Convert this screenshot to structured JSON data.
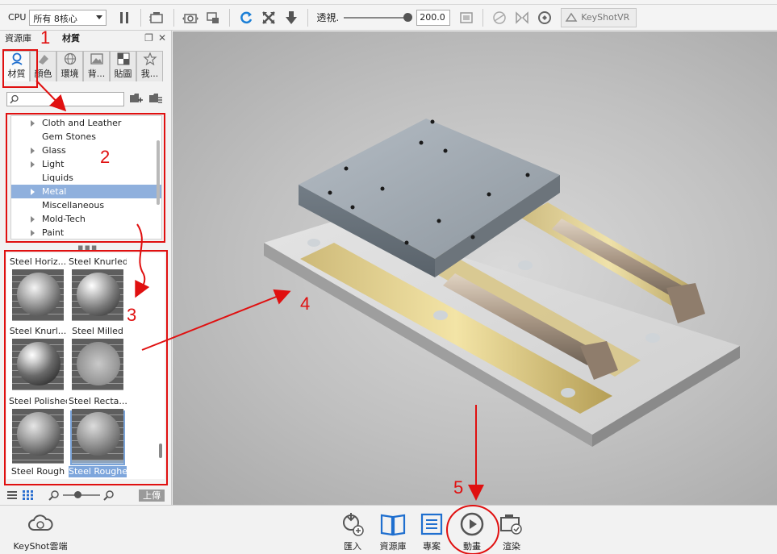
{
  "toolbar": {
    "cpu_label": "CPU",
    "cpu_select": "所有 8核心",
    "perspective_label": "透視.",
    "perspective_value": "200.0",
    "keyshotvr_label": "KeyShotVR"
  },
  "library": {
    "title": "資源庫",
    "subtitle": "材質",
    "tabs": [
      {
        "label": "材質",
        "icon": "material-icon",
        "active": true
      },
      {
        "label": "顏色",
        "icon": "color-icon",
        "active": false
      },
      {
        "label": "環境",
        "icon": "globe-icon",
        "active": false
      },
      {
        "label": "背...",
        "icon": "image-icon",
        "active": false
      },
      {
        "label": "貼圖",
        "icon": "texture-icon",
        "active": false
      },
      {
        "label": "我...",
        "icon": "star-icon",
        "active": false
      }
    ],
    "search_value": "",
    "categories": [
      {
        "label": "Cloth and Leather",
        "expandable": true,
        "selected": false
      },
      {
        "label": "Gem Stones",
        "expandable": false,
        "selected": false
      },
      {
        "label": "Glass",
        "expandable": true,
        "selected": false
      },
      {
        "label": "Light",
        "expandable": true,
        "selected": false
      },
      {
        "label": "Liquids",
        "expandable": false,
        "selected": false
      },
      {
        "label": "Metal",
        "expandable": true,
        "selected": true
      },
      {
        "label": "Miscellaneous",
        "expandable": false,
        "selected": false
      },
      {
        "label": "Mold-Tech",
        "expandable": true,
        "selected": false
      },
      {
        "label": "Paint",
        "expandable": true,
        "selected": false
      }
    ],
    "materials": [
      {
        "label": "Steel Horiz...",
        "selected": false
      },
      {
        "label": "Steel Knurled",
        "selected": false
      },
      {
        "label": "Steel Knurl...",
        "selected": false
      },
      {
        "label": "Steel Milled",
        "selected": false
      },
      {
        "label": "Steel Polished",
        "selected": false
      },
      {
        "label": "Steel Recta...",
        "selected": false
      },
      {
        "label": "Steel Rough",
        "selected": false
      },
      {
        "label": "Steel Rougher",
        "selected": true
      }
    ],
    "upload_label": "上傳"
  },
  "bottom_bar": {
    "cloud_label": "KeyShot雲端",
    "items": [
      {
        "label": "匯入",
        "icon": "import-icon"
      },
      {
        "label": "資源庫",
        "icon": "library-book-icon"
      },
      {
        "label": "專案",
        "icon": "project-list-icon"
      },
      {
        "label": "動畫",
        "icon": "animation-play-icon"
      },
      {
        "label": "渲染",
        "icon": "render-camera-icon"
      }
    ]
  },
  "annotations": {
    "step1": "1",
    "step2": "2",
    "step3": "3",
    "step4": "4",
    "step5": "5",
    "color": "#e01010"
  }
}
